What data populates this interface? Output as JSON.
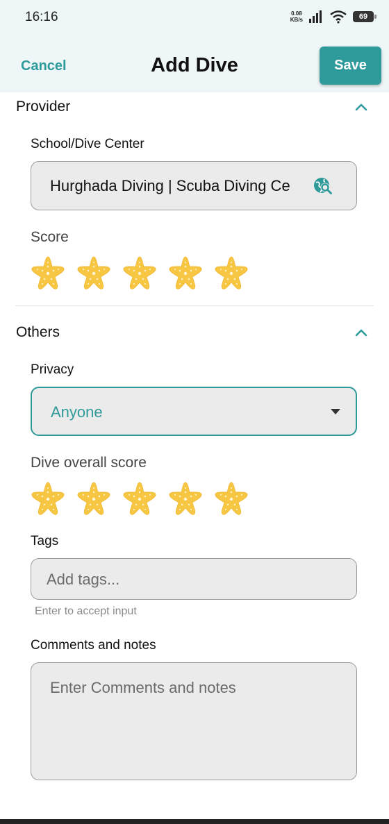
{
  "status": {
    "time": "16:16",
    "net_speed_value": "0.08",
    "net_speed_unit": "KB/s",
    "battery": "69"
  },
  "header": {
    "cancel_label": "Cancel",
    "title": "Add Dive",
    "save_label": "Save"
  },
  "provider": {
    "title": "Provider",
    "school_label": "School/Dive Center",
    "school_value": "Hurghada Diving | Scuba Diving Ce",
    "score_label": "Score",
    "score": 5
  },
  "others": {
    "title": "Others",
    "privacy_label": "Privacy",
    "privacy_value": "Anyone",
    "overall_label": "Dive overall score",
    "overall_score": 5,
    "tags_label": "Tags",
    "tags_placeholder": "Add tags...",
    "tags_helper": "Enter to accept input",
    "comments_label": "Comments and notes",
    "comments_placeholder": "Enter Comments and notes"
  },
  "icons": {
    "chevron": "chevron-up-icon",
    "search": "globe-search-icon",
    "dropdown": "dropdown-arrow-icon",
    "star": "starfish-icon"
  },
  "colors": {
    "accent": "#2e9a9a",
    "star": "#f7c744",
    "header_bg": "#eef6f8",
    "field_bg": "#ebebeb"
  }
}
